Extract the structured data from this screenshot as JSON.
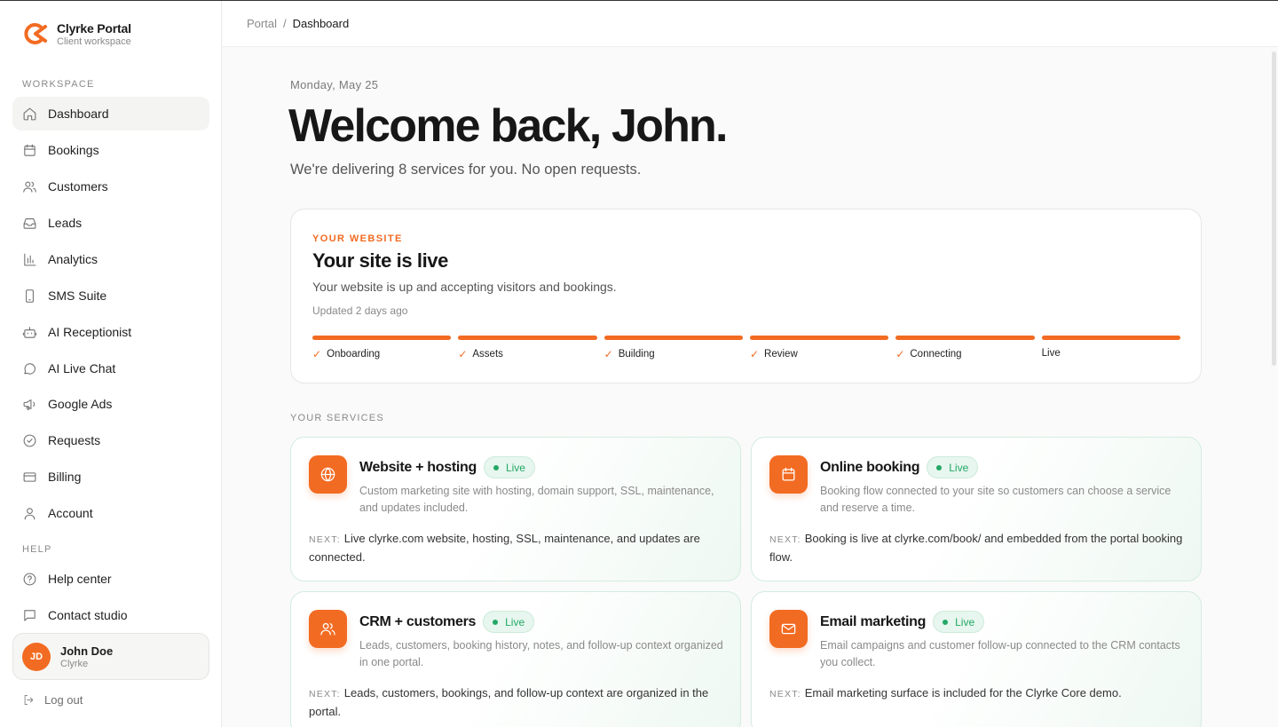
{
  "brand": {
    "name": "Clyrke Portal",
    "tagline": "Client workspace",
    "accent": "#f26b22"
  },
  "sidebar": {
    "workspace_label": "WORKSPACE",
    "help_label": "HELP",
    "items": [
      {
        "label": "Dashboard",
        "icon": "home-icon"
      },
      {
        "label": "Bookings",
        "icon": "calendar-icon"
      },
      {
        "label": "Customers",
        "icon": "users-icon"
      },
      {
        "label": "Leads",
        "icon": "inbox-icon"
      },
      {
        "label": "Analytics",
        "icon": "bar-chart-icon"
      },
      {
        "label": "SMS Suite",
        "icon": "phone-icon"
      },
      {
        "label": "AI Receptionist",
        "icon": "bot-icon"
      },
      {
        "label": "AI Live Chat",
        "icon": "chat-bubble-icon"
      },
      {
        "label": "Google Ads",
        "icon": "megaphone-icon"
      },
      {
        "label": "Requests",
        "icon": "check-circle-icon"
      },
      {
        "label": "Billing",
        "icon": "credit-card-icon"
      },
      {
        "label": "Account",
        "icon": "user-icon"
      }
    ],
    "help_items": [
      {
        "label": "Help center",
        "icon": "help-circle-icon"
      },
      {
        "label": "Contact studio",
        "icon": "message-square-icon"
      }
    ],
    "user": {
      "initials": "JD",
      "name": "John Doe",
      "org": "Clyrke"
    },
    "logout_label": "Log out"
  },
  "breadcrumb": {
    "root": "Portal",
    "separator": "/",
    "current": "Dashboard"
  },
  "main": {
    "date": "Monday, May 25",
    "welcome": "Welcome back, John.",
    "subtitle": "We're delivering 8 services for you. No open requests."
  },
  "site": {
    "eyebrow": "YOUR WEBSITE",
    "title": "Your site is live",
    "description": "Your website is up and accepting visitors and bookings.",
    "updated": "Updated 2 days ago",
    "steps": [
      {
        "label": "Onboarding",
        "done": true
      },
      {
        "label": "Assets",
        "done": true
      },
      {
        "label": "Building",
        "done": true
      },
      {
        "label": "Review",
        "done": true
      },
      {
        "label": "Connecting",
        "done": true
      },
      {
        "label": "Live",
        "done": false
      }
    ]
  },
  "services": {
    "label": "YOUR SERVICES",
    "next_label": "NEXT:",
    "items": [
      {
        "name": "Website + hosting",
        "status": "Live",
        "icon": "globe-icon",
        "description": "Custom marketing site with hosting, domain support, SSL, maintenance, and updates included.",
        "next": "Live clyrke.com website, hosting, SSL, maintenance, and updates are connected."
      },
      {
        "name": "Online booking",
        "status": "Live",
        "icon": "calendar-icon",
        "description": "Booking flow connected to your site so customers can choose a service and reserve a time.",
        "next": "Booking is live at clyrke.com/book/ and embedded from the portal booking flow."
      },
      {
        "name": "CRM + customers",
        "status": "Live",
        "icon": "users-icon",
        "description": "Leads, customers, booking history, notes, and follow-up context organized in one portal.",
        "next": "Leads, customers, bookings, and follow-up context are organized in the portal."
      },
      {
        "name": "Email marketing",
        "status": "Live",
        "icon": "mail-icon",
        "description": "Email campaigns and customer follow-up connected to the CRM contacts you collect.",
        "next": "Email marketing surface is included for the Clyrke Core demo."
      }
    ]
  }
}
